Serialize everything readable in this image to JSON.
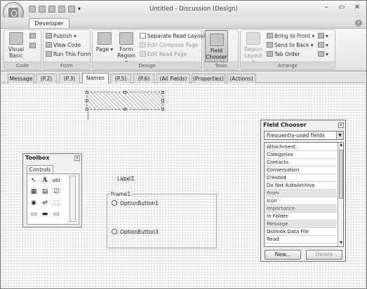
{
  "window": {
    "title": "Untitled - Discussion  (Design)",
    "controls": [
      "–",
      "▭",
      "✕"
    ]
  },
  "quick_access": [
    "save-icon",
    "undo-icon",
    "redo-icon",
    "up-icon",
    "down-icon",
    "customize-icon"
  ],
  "ribbon": {
    "active_tab": "Developer",
    "groups": {
      "code": {
        "label": "Code",
        "visual_basic": "Visual Basic"
      },
      "form": {
        "label": "Form",
        "publish": "Publish",
        "view_code": "View Code",
        "run_this_form": "Run This Form"
      },
      "design": {
        "label": "Design",
        "page": "Page",
        "form_region": "Form Region",
        "separate_read_layout": "Separate Read Layout",
        "edit_compose_page": "Edit Compose Page",
        "edit_read_page": "Edit Read Page"
      },
      "tools": {
        "label": "Tools",
        "field_chooser": "Field Chooser"
      },
      "arrange": {
        "label": "Arrange",
        "region_layout": "Region Layout",
        "bring_to_front": "Bring to Front",
        "send_to_back": "Send to Back",
        "tab_order": "Tab Order"
      }
    }
  },
  "page_tabs": [
    "Message",
    "(P.2)",
    "(P.3)",
    "Names",
    "(P.5)",
    "(P.6)",
    "(All Fields)",
    "(Properties)",
    "(Actions)"
  ],
  "active_page_tab": "Names",
  "canvas": {
    "label1": "Label1",
    "frame_caption": "Frame1",
    "option1": "OptionButton1",
    "option3": "OptionButton3"
  },
  "toolbox": {
    "title": "Toolbox",
    "tab": "Controls",
    "close": "x"
  },
  "field_chooser": {
    "title": "Field Chooser",
    "close": "x",
    "selected": "Frequently-used fields",
    "fields": [
      "Attachment",
      "Categories",
      "Contacts",
      "Conversation",
      "Created",
      "Do Not AutoArchive",
      "From",
      "Icon",
      "Importance",
      "In Folder",
      "Message",
      "Outlook Data File",
      "Read"
    ],
    "new_button": "New...",
    "delete_button": "Delete"
  }
}
